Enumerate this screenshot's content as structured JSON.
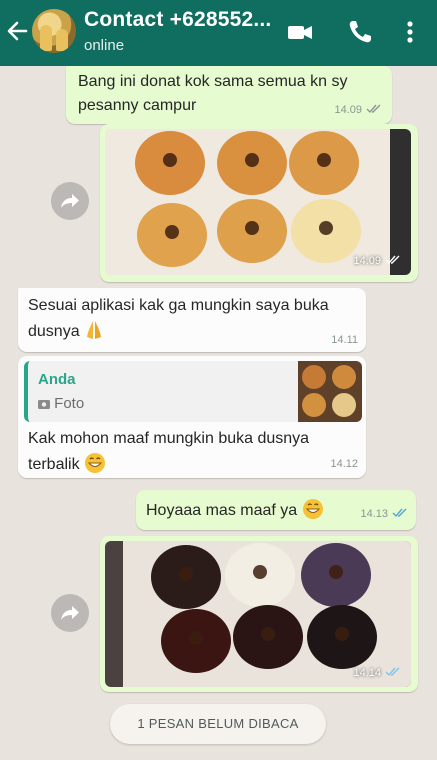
{
  "header": {
    "contact_name": "Contact +628552...",
    "status": "online",
    "icons": [
      "back-arrow-icon",
      "avatar",
      "video-call-icon",
      "phone-icon",
      "more-options-icon"
    ]
  },
  "colors": {
    "header": "#0f6e5f",
    "outgoing_bubble": "#e6fbcf",
    "incoming_bubble": "#fcfcfc",
    "read_ticks": "#4fa6d8",
    "quote_accent": "#2aa58a"
  },
  "messages": [
    {
      "type": "text",
      "direction": "outgoing",
      "text": "Bang ini donat kok sama semua  kn sy pesanny campur",
      "time": "14.09"
    },
    {
      "type": "image",
      "direction": "outgoing",
      "description_icon": "donut-photo",
      "time": "14.09"
    },
    {
      "type": "text",
      "direction": "incoming",
      "text": "Sesuai aplikasi kak ga mungkin saya buka dusnya",
      "time": "14.11"
    },
    {
      "type": "reply",
      "direction": "incoming",
      "quote_author": "Anda",
      "quote_text": "Foto",
      "text": "Kak mohon maaf mungkin buka dusnya terbalik",
      "time": "14.12"
    },
    {
      "type": "text",
      "direction": "outgoing",
      "text": "Hoyaaa mas maaf ya",
      "time": "14.13"
    },
    {
      "type": "image",
      "direction": "outgoing",
      "description_icon": "donut-photo",
      "time": "14.14"
    }
  ],
  "unread_banner": "1 PESAN BELUM DIBACA"
}
